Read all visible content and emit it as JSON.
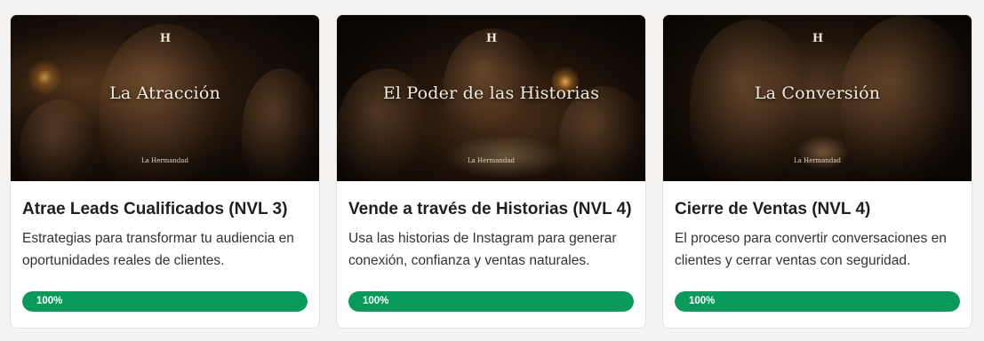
{
  "courses": [
    {
      "image": {
        "logo": "H",
        "title": "La Atracción",
        "brand": "La Hermandad"
      },
      "title": "Atrae Leads Cualificados (NVL 3)",
      "description": "Estrategias para transformar tu audiencia en oportunidades reales de clientes.",
      "progress_label": "100%",
      "progress": 1.0,
      "progress_color": "#079a5a"
    },
    {
      "image": {
        "logo": "H",
        "title": "El Poder de las Historias",
        "brand": "La Hermandad"
      },
      "title": "Vende a través de Historias (NVL 4)",
      "description": "Usa las historias de Instagram para generar conexión, confianza y ventas naturales.",
      "progress_label": "100%",
      "progress": 1.0,
      "progress_color": "#079a5a"
    },
    {
      "image": {
        "logo": "H",
        "title": "La Conversión",
        "brand": "La Hermandad"
      },
      "title": "Cierre de Ventas (NVL 4)",
      "description": "El proceso para convertir conversaciones en clientes y cerrar ventas con seguridad.",
      "progress_label": "100%",
      "progress": 1.0,
      "progress_color": "#079a5a"
    }
  ]
}
